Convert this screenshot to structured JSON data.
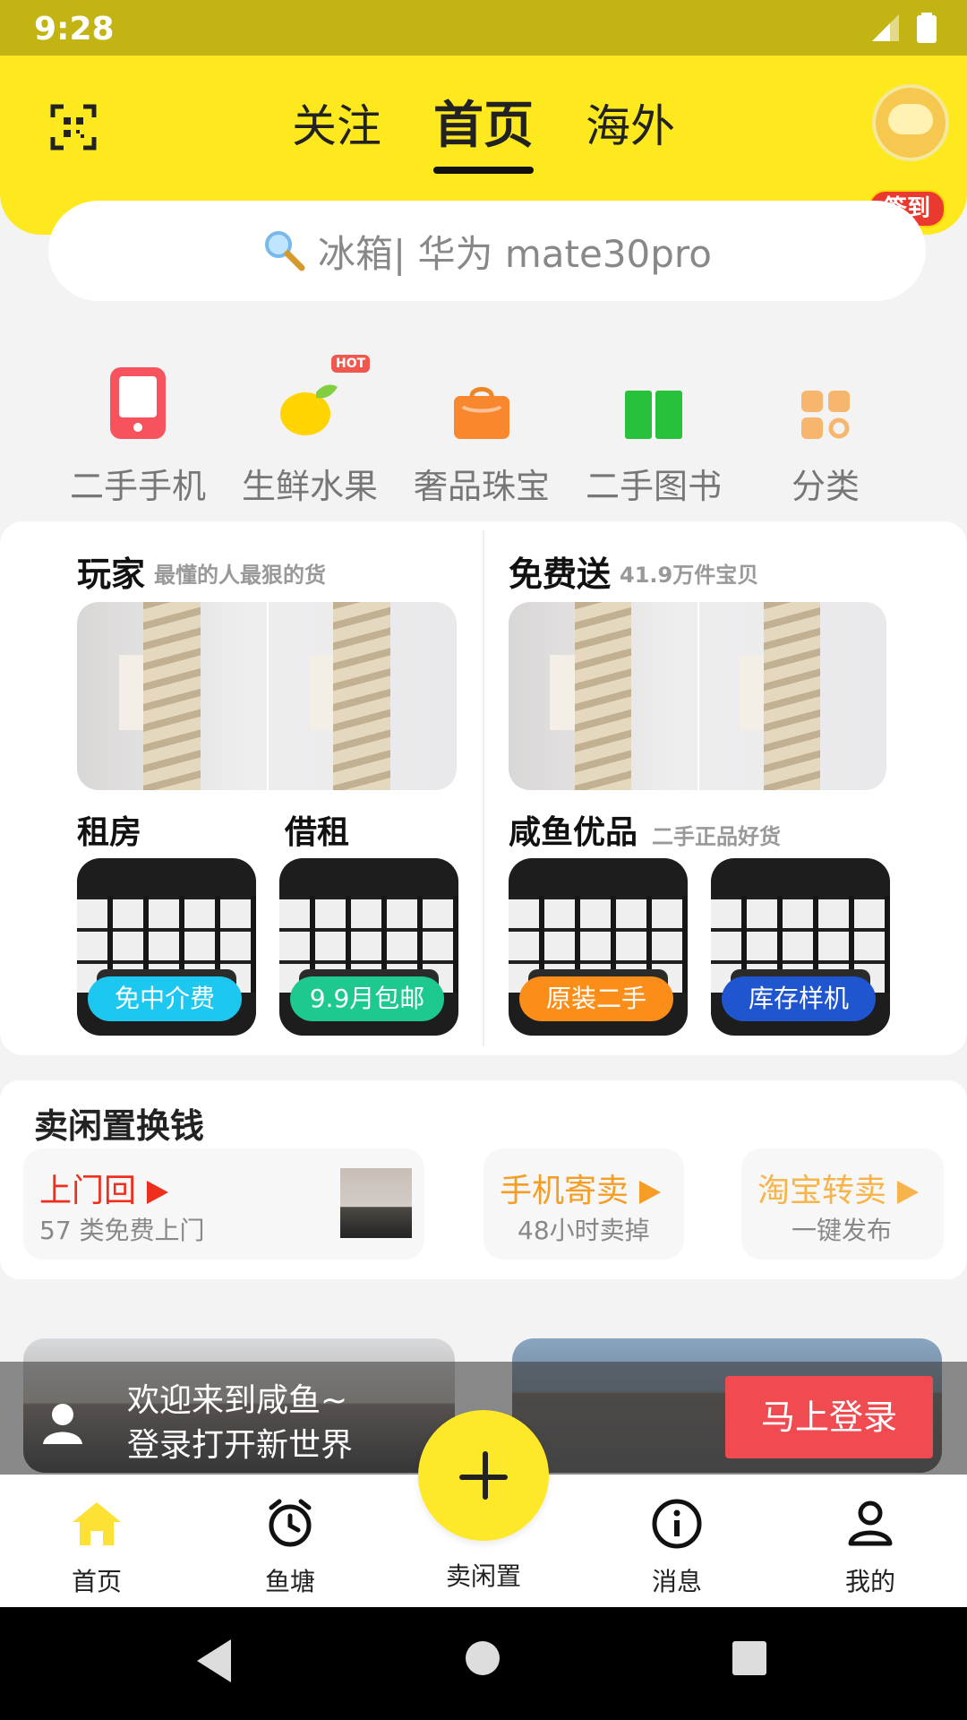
{
  "status_bar": {
    "time": "9:28"
  },
  "header": {
    "tabs": [
      {
        "label": "关注",
        "active": false
      },
      {
        "label": "首页",
        "active": true
      },
      {
        "label": "海外",
        "active": false
      }
    ],
    "sign_in_badge": "签到",
    "search_placeholder": "冰箱| 华为 mate30pro"
  },
  "categories": [
    {
      "label": "二手手机",
      "icon": "phone-icon"
    },
    {
      "label": "生鲜水果",
      "icon": "lemon-icon",
      "badge": "HOT"
    },
    {
      "label": "奢品珠宝",
      "icon": "bag-icon"
    },
    {
      "label": "二手图书",
      "icon": "book-icon"
    },
    {
      "label": "分类",
      "icon": "grid-icon"
    }
  ],
  "featured": {
    "left": {
      "title": "玩家",
      "subtitle": "最懂的人最狠的货",
      "sub_sections": [
        {
          "title": "租房",
          "tag": "免中介费",
          "tag_color": "#1cc8ef"
        },
        {
          "title": "借租",
          "tag": "9.9月包邮",
          "tag_color": "#1dc98e"
        }
      ]
    },
    "right": {
      "title": "免费送",
      "subtitle": "41.9万件宝贝",
      "sub_title": "咸鱼优品",
      "sub_subtitle": "二手正品好货",
      "tags": [
        {
          "label": "原装二手",
          "color": "#fb8d19"
        },
        {
          "label": "库存样机",
          "color": "#1f56cf"
        }
      ]
    }
  },
  "sell_section": {
    "title": "卖闲置换钱",
    "items": [
      {
        "title": "上门回",
        "subtitle": "57 类免费上门",
        "color": "#ef2f1e"
      },
      {
        "title": "手机寄卖",
        "subtitle": "48小时卖掉",
        "color": "#f59d25"
      },
      {
        "title": "淘宝转卖",
        "subtitle": "一键发布",
        "color": "#f7b44a"
      }
    ]
  },
  "login_banner": {
    "line1": "欢迎来到咸鱼~",
    "line2": "登录打开新世界",
    "button": "马上登录"
  },
  "bottom_nav": [
    {
      "label": "首页",
      "icon": "home-icon",
      "active": true
    },
    {
      "label": "鱼塘",
      "icon": "alarm-clock-icon"
    },
    {
      "label": "卖闲置",
      "icon": "plus-icon"
    },
    {
      "label": "消息",
      "icon": "info-icon"
    },
    {
      "label": "我的",
      "icon": "profile-icon"
    }
  ],
  "colors": {
    "header_yellow": "#fde91e",
    "status_bar": "#c2b413",
    "login_button": "#f04b50"
  }
}
